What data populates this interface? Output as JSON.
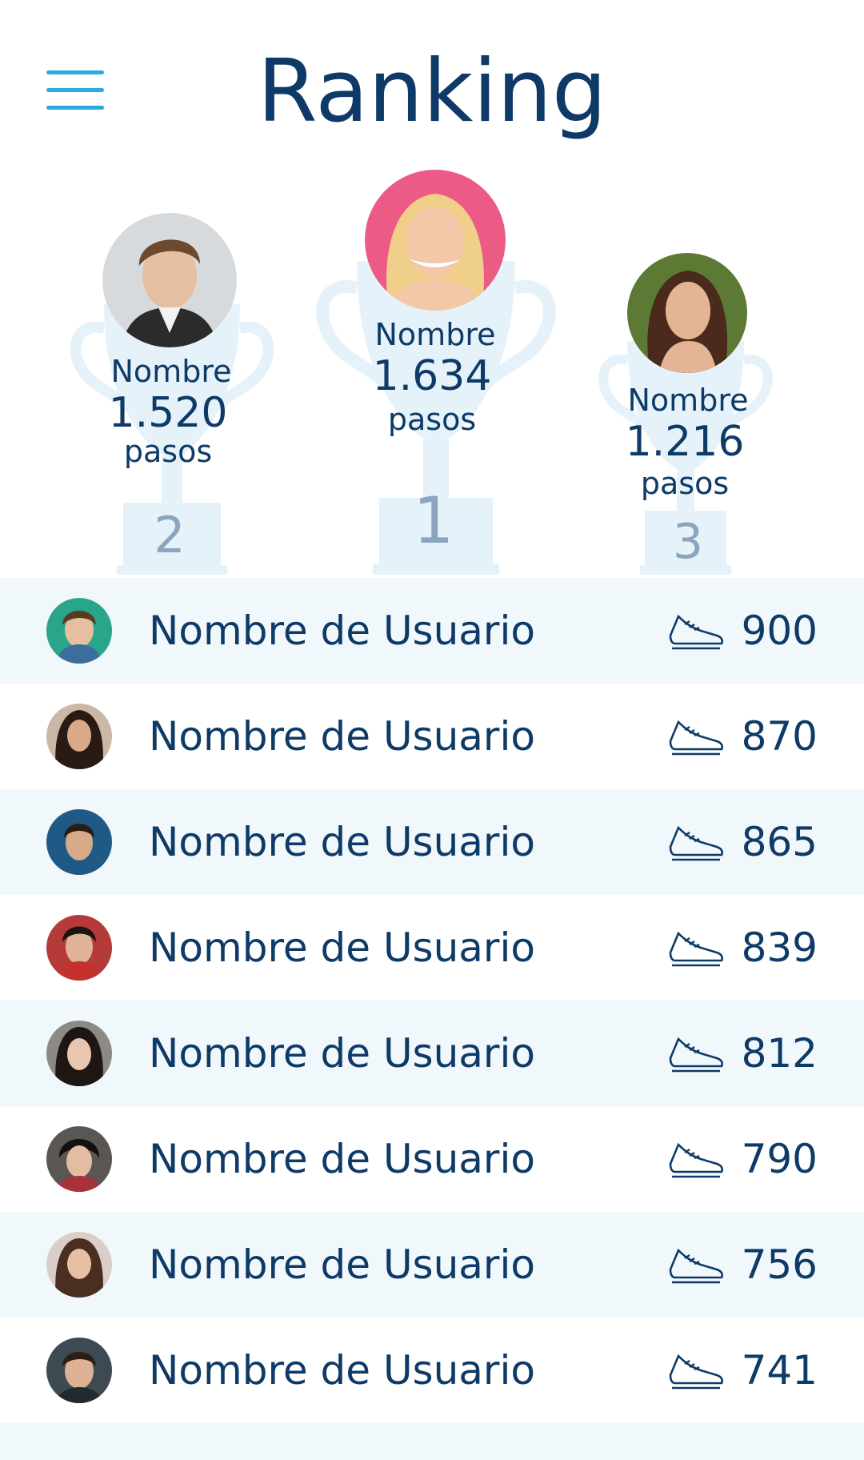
{
  "header": {
    "title": "Ranking",
    "menu_icon": "hamburger-menu-icon"
  },
  "colors": {
    "primary_text": "#0d3a66",
    "accent": "#29abe2",
    "row_shade": "#f1f8fc",
    "trophy": "#e6f2f9",
    "rank_number": "#8aa5bd"
  },
  "podium": {
    "first": {
      "rank": "1",
      "name": "Nombre",
      "steps": "1.634",
      "unit": "pasos"
    },
    "second": {
      "rank": "2",
      "name": "Nombre",
      "steps": "1.520",
      "unit": "pasos"
    },
    "third": {
      "rank": "3",
      "name": "Nombre",
      "steps": "1.216",
      "unit": "pasos"
    }
  },
  "ranking": [
    {
      "name": "Nombre de Usuario",
      "steps": "900"
    },
    {
      "name": "Nombre de Usuario",
      "steps": "870"
    },
    {
      "name": "Nombre de Usuario",
      "steps": "865"
    },
    {
      "name": "Nombre de Usuario",
      "steps": "839"
    },
    {
      "name": "Nombre de Usuario",
      "steps": "812"
    },
    {
      "name": "Nombre de Usuario",
      "steps": "790"
    },
    {
      "name": "Nombre de Usuario",
      "steps": "756"
    },
    {
      "name": "Nombre de Usuario",
      "steps": "741"
    }
  ]
}
